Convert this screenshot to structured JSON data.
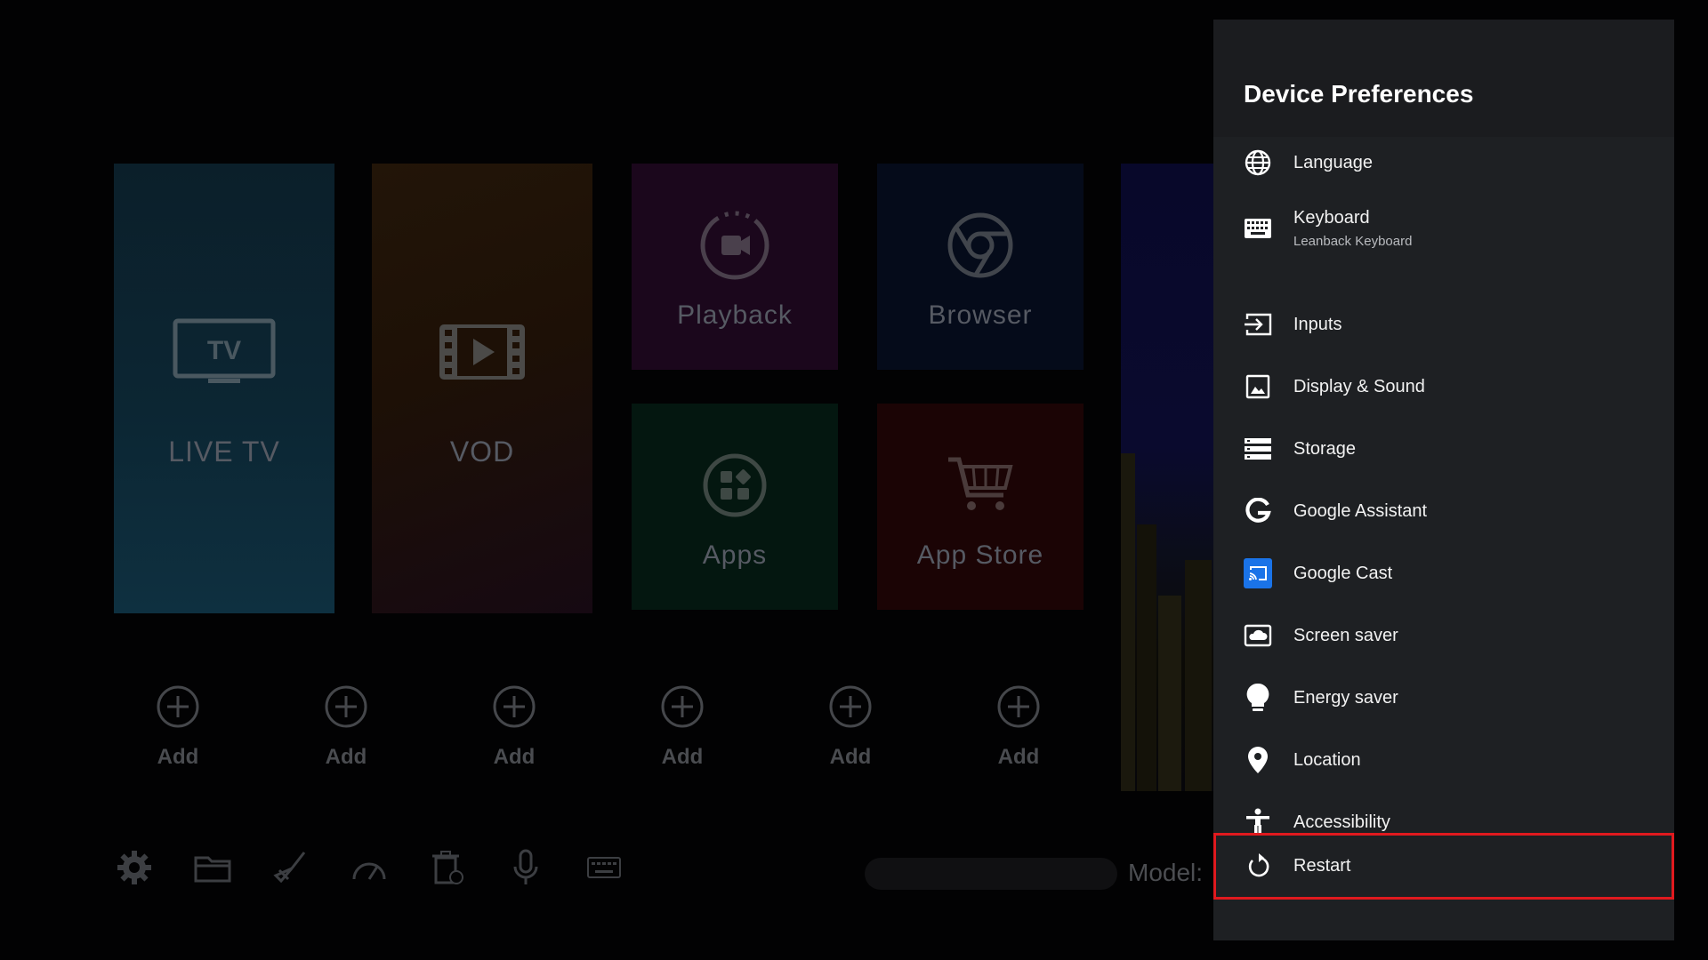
{
  "launcher": {
    "tiles": [
      {
        "label": "LIVE TV",
        "icon": "tv-icon",
        "icon_text": "TV"
      },
      {
        "label": "VOD",
        "icon": "film-play-icon"
      },
      {
        "label": "Playback",
        "icon": "playback-icon"
      },
      {
        "label": "Browser",
        "icon": "browser-icon"
      },
      {
        "label": "Apps",
        "icon": "apps-grid-icon"
      },
      {
        "label": "App Store",
        "icon": "cart-icon"
      }
    ],
    "add_slots": [
      "Add",
      "Add",
      "Add",
      "Add",
      "Add",
      "Add"
    ],
    "toolbar_icons": [
      "gear-icon",
      "folder-icon",
      "broom-icon",
      "speedometer-icon",
      "trash-icon",
      "microphone-icon",
      "keyboard-icon"
    ],
    "model_label": "Model:"
  },
  "panel": {
    "title": "Device Preferences",
    "items": [
      {
        "label": "Language",
        "icon": "globe-icon"
      },
      {
        "label": "Keyboard",
        "sublabel": "Leanback Keyboard",
        "icon": "keyboard-icon"
      },
      {
        "label": "Inputs",
        "icon": "input-icon"
      },
      {
        "label": "Display & Sound",
        "icon": "image-icon"
      },
      {
        "label": "Storage",
        "icon": "storage-icon"
      },
      {
        "label": "Google Assistant",
        "icon": "google-g-icon"
      },
      {
        "label": "Google Cast",
        "icon": "cast-icon"
      },
      {
        "label": "Screen saver",
        "icon": "screensaver-icon"
      },
      {
        "label": "Energy saver",
        "icon": "lightbulb-icon"
      },
      {
        "label": "Location",
        "icon": "location-pin-icon"
      },
      {
        "label": "Accessibility",
        "icon": "accessibility-icon"
      },
      {
        "label": "Restart",
        "icon": "restart-icon"
      }
    ]
  },
  "colors": {
    "panel_bg": "#1e2023",
    "highlight": "#e0191e",
    "cast_blue": "#1a73e8"
  }
}
